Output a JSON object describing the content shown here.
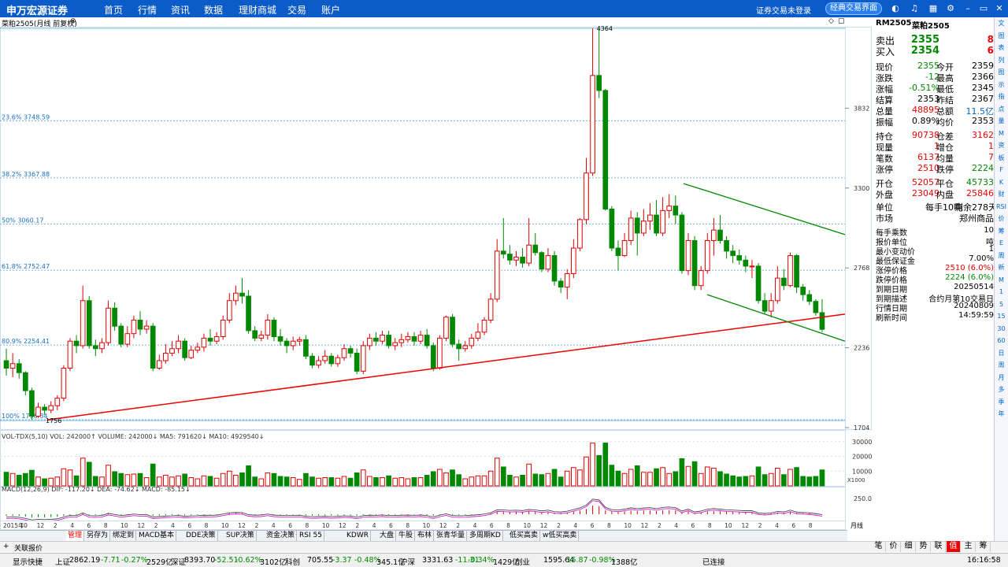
{
  "topbar": {
    "brand": "申万宏源证券",
    "nav": [
      "首页",
      "行情",
      "资讯",
      "数据",
      "理财商城",
      "交易",
      "账户"
    ],
    "status": "证券交易未登录",
    "classic_button": "经典交易界面"
  },
  "header": {
    "title": "菜粕2505(月线 前复权)"
  },
  "chart_data": [
    {
      "type": "candlestick",
      "title": "菜粕2505(月线 前复权)",
      "x_labels": [
        "2015年",
        "10",
        "12",
        "2",
        "4",
        "6",
        "8",
        "10",
        "12",
        "2",
        "4",
        "6",
        "8",
        "10",
        "12",
        "2",
        "4",
        "6",
        "8",
        "10",
        "12",
        "2",
        "4",
        "6",
        "8",
        "10",
        "12",
        "2",
        "4",
        "6",
        "8",
        "10",
        "12",
        "2",
        "4",
        "6",
        "8",
        "10",
        "12",
        "2",
        "4",
        "6",
        "8",
        "10",
        "12",
        "2",
        "4",
        "6",
        "8"
      ],
      "y_ticks": [
        1704,
        2236,
        2768,
        3300,
        3832
      ],
      "ylim": [
        1704,
        4364
      ],
      "fib_levels": [
        {
          "label": "23.6% 3748.59",
          "value": 3748.59
        },
        {
          "label": "38.2% 3367.88",
          "value": 3367.88
        },
        {
          "label": "50% 3060.17",
          "value": 3060.17
        },
        {
          "label": "61.8% 2752.47",
          "value": 2752.47
        },
        {
          "label": "80.9% 2254.41",
          "value": 2254.41
        },
        {
          "label": "100% 1756.34",
          "value": 1756.34
        }
      ],
      "annotations": [
        {
          "text": "4364",
          "value": 4364
        },
        {
          "text": "1756",
          "value": 1756.34
        }
      ],
      "candles": [
        [
          2150,
          2100,
          2230,
          2050
        ],
        [
          2100,
          2130,
          2200,
          2040
        ],
        [
          2130,
          2070,
          2160,
          2030
        ],
        [
          2070,
          1950,
          2080,
          1920
        ],
        [
          1950,
          1780,
          1970,
          1756
        ],
        [
          1780,
          1840,
          1870,
          1770
        ],
        [
          1840,
          1820,
          1860,
          1790
        ],
        [
          1820,
          1850,
          1880,
          1800
        ],
        [
          1850,
          1900,
          1920,
          1820
        ],
        [
          1900,
          2100,
          2120,
          1880
        ],
        [
          2100,
          2280,
          2300,
          2080
        ],
        [
          2280,
          2250,
          2320,
          2200
        ],
        [
          2250,
          2550,
          2650,
          2230
        ],
        [
          2550,
          2250,
          2580,
          2230
        ],
        [
          2250,
          2230,
          2290,
          2180
        ],
        [
          2230,
          2270,
          2300,
          2200
        ],
        [
          2270,
          2500,
          2550,
          2250
        ],
        [
          2500,
          2380,
          2540,
          2350
        ],
        [
          2380,
          2260,
          2400,
          2240
        ],
        [
          2260,
          2330,
          2380,
          2240
        ],
        [
          2330,
          2420,
          2450,
          2300
        ],
        [
          2420,
          2360,
          2480,
          2320
        ],
        [
          2360,
          2380,
          2420,
          2330
        ],
        [
          2380,
          2100,
          2400,
          2080
        ],
        [
          2100,
          2150,
          2190,
          2090
        ],
        [
          2150,
          2200,
          2260,
          2130
        ],
        [
          2200,
          2230,
          2280,
          2180
        ],
        [
          2230,
          2280,
          2320,
          2200
        ],
        [
          2280,
          2170,
          2300,
          2150
        ],
        [
          2170,
          2220,
          2250,
          2160
        ],
        [
          2220,
          2240,
          2270,
          2200
        ],
        [
          2240,
          2300,
          2330,
          2210
        ],
        [
          2300,
          2280,
          2360,
          2250
        ],
        [
          2280,
          2310,
          2340,
          2260
        ],
        [
          2310,
          2420,
          2450,
          2290
        ],
        [
          2420,
          2550,
          2600,
          2400
        ],
        [
          2550,
          2600,
          2650,
          2520
        ],
        [
          2600,
          2580,
          2700,
          2530
        ],
        [
          2580,
          2350,
          2620,
          2330
        ],
        [
          2350,
          2300,
          2380,
          2280
        ],
        [
          2300,
          2320,
          2350,
          2280
        ],
        [
          2320,
          2420,
          2460,
          2290
        ],
        [
          2420,
          2310,
          2440,
          2280
        ],
        [
          2310,
          2280,
          2360,
          2250
        ],
        [
          2280,
          2250,
          2300,
          2200
        ],
        [
          2250,
          2280,
          2310,
          2220
        ],
        [
          2280,
          2290,
          2310,
          2250
        ],
        [
          2290,
          2180,
          2320,
          2160
        ],
        [
          2180,
          2120,
          2200,
          2100
        ],
        [
          2120,
          2150,
          2180,
          2100
        ],
        [
          2150,
          2180,
          2220,
          2130
        ],
        [
          2180,
          2130,
          2200,
          2110
        ],
        [
          2130,
          2170,
          2190,
          2110
        ],
        [
          2170,
          2230,
          2260,
          2150
        ],
        [
          2230,
          2200,
          2250,
          2170
        ],
        [
          2200,
          2080,
          2230,
          2060
        ],
        [
          2080,
          2250,
          2280,
          2060
        ],
        [
          2250,
          2300,
          2330,
          2220
        ],
        [
          2300,
          2280,
          2340,
          2250
        ],
        [
          2280,
          2320,
          2350,
          2260
        ],
        [
          2320,
          2250,
          2350,
          2230
        ],
        [
          2250,
          2270,
          2300,
          2220
        ],
        [
          2270,
          2290,
          2330,
          2240
        ],
        [
          2290,
          2310,
          2340,
          2270
        ],
        [
          2310,
          2280,
          2340,
          2250
        ],
        [
          2280,
          2320,
          2350,
          2260
        ],
        [
          2320,
          2250,
          2360,
          2230
        ],
        [
          2250,
          2100,
          2270,
          2080
        ],
        [
          2100,
          2300,
          2320,
          2090
        ],
        [
          2300,
          2440,
          2450,
          2280
        ],
        [
          2440,
          2260,
          2460,
          2240
        ],
        [
          2260,
          2230,
          2290,
          2150
        ],
        [
          2230,
          2250,
          2280,
          2210
        ],
        [
          2250,
          2300,
          2330,
          2230
        ],
        [
          2300,
          2340,
          2400,
          2280
        ],
        [
          2340,
          2420,
          2440,
          2320
        ],
        [
          2420,
          2560,
          2600,
          2400
        ],
        [
          2560,
          2880,
          2960,
          2540
        ],
        [
          2880,
          2860,
          3100,
          2830
        ],
        [
          2860,
          2820,
          2920,
          2790
        ],
        [
          2820,
          2840,
          2880,
          2780
        ],
        [
          2840,
          2800,
          2900,
          2770
        ],
        [
          2800,
          2920,
          3100,
          2780
        ],
        [
          2920,
          2870,
          3000,
          2850
        ],
        [
          2870,
          2760,
          2880,
          2740
        ],
        [
          2760,
          2850,
          2900,
          2740
        ],
        [
          2850,
          2680,
          2880,
          2650
        ],
        [
          2680,
          2640,
          2700,
          2600
        ],
        [
          2640,
          2730,
          2760,
          2560
        ],
        [
          2730,
          2900,
          2960,
          2700
        ],
        [
          2900,
          3090,
          3100,
          2880
        ],
        [
          3090,
          3400,
          3500,
          3060
        ],
        [
          3400,
          4050,
          4364,
          3380
        ],
        [
          4050,
          3950,
          4364,
          3900
        ],
        [
          3950,
          3160,
          3960,
          3150
        ],
        [
          3160,
          2900,
          3180,
          2880
        ],
        [
          2900,
          2850,
          2950,
          2750
        ],
        [
          2850,
          2950,
          3000,
          2840
        ],
        [
          2950,
          3100,
          3150,
          2920
        ],
        [
          3100,
          3000,
          3140,
          2850
        ],
        [
          3000,
          3080,
          3160,
          2980
        ],
        [
          3080,
          3120,
          3200,
          3020
        ],
        [
          3120,
          3000,
          3220,
          2980
        ],
        [
          3000,
          3150,
          3240,
          2980
        ],
        [
          3150,
          3180,
          3260,
          3100
        ],
        [
          3180,
          3120,
          3250,
          3060
        ],
        [
          3120,
          2750,
          3140,
          2730
        ],
        [
          2750,
          2950,
          3000,
          2720
        ],
        [
          2950,
          2650,
          2980,
          2620
        ],
        [
          2650,
          2750,
          2780,
          2620
        ],
        [
          2750,
          2950,
          3000,
          2730
        ],
        [
          2950,
          3020,
          3100,
          2850
        ],
        [
          3020,
          2950,
          3120,
          2930
        ],
        [
          2950,
          2880,
          2980,
          2830
        ],
        [
          2880,
          2850,
          2920,
          2800
        ],
        [
          2850,
          2820,
          2890,
          2790
        ],
        [
          2820,
          2780,
          2850,
          2740
        ],
        [
          2780,
          2780,
          2820,
          2700
        ],
        [
          2780,
          2550,
          2800,
          2530
        ],
        [
          2550,
          2480,
          2600,
          2460
        ],
        [
          2480,
          2550,
          2600,
          2440
        ],
        [
          2550,
          2700,
          2780,
          2530
        ],
        [
          2700,
          2650,
          2760,
          2620
        ],
        [
          2650,
          2850,
          2870,
          2640
        ],
        [
          2850,
          2640,
          2860,
          2600
        ],
        [
          2640,
          2590,
          2660,
          2550
        ],
        [
          2590,
          2545,
          2620,
          2520
        ],
        [
          2545,
          2470,
          2560,
          2450
        ],
        [
          2470,
          2359,
          2560,
          2340
        ]
      ]
    },
    {
      "type": "bar",
      "title": "VOL-TDX(5,10)",
      "series": [
        {
          "name": "VOLUME",
          "value": 242000
        },
        {
          "name": "MA5",
          "value": 791620
        },
        {
          "name": "MA10",
          "value": 4929540
        }
      ],
      "y_ticks": [
        10000,
        20000,
        30000
      ],
      "scale_label": "X1000"
    },
    {
      "type": "line",
      "title": "MACD(12,26,9)",
      "series": [
        {
          "name": "DIF",
          "value": -117.2
        },
        {
          "name": "DEA",
          "value": -74.62
        },
        {
          "name": "MACD",
          "value": -85.15
        }
      ],
      "y_ticks": [
        250.0
      ]
    }
  ],
  "panels": {
    "vol_header": "VOL-TDX(5,10) VOL: 242000↑ VOLUME: 242000↓ MA5: 791620↓ MA10: 4929540↓",
    "macd_header": "MACD(12,26,9) DIF: -117.20↓ DEA: -74.62↓ MACD: -85.15↓",
    "period": "月线"
  },
  "quote": {
    "code": "RM2505",
    "name": "菜粕2505",
    "sell": {
      "label": "卖出",
      "price": "2355",
      "vol": "8"
    },
    "buy": {
      "label": "买入",
      "price": "2354",
      "vol": "6"
    },
    "rows1": [
      [
        "现价",
        "2355",
        "今开",
        "2359"
      ],
      [
        "涨跌",
        "-12",
        "最高",
        "2366"
      ],
      [
        "涨幅",
        "-0.51%",
        "最低",
        "2345"
      ],
      [
        "结算",
        "2353",
        "昨结",
        "2367"
      ],
      [
        "总量",
        "48895",
        "总额",
        "11.5亿"
      ],
      [
        "振幅",
        "0.89%",
        "均价",
        "2353"
      ]
    ],
    "rows2": [
      [
        "持仓",
        "90738",
        "仓差",
        "3162"
      ],
      [
        "现量",
        "1",
        "增仓",
        "1"
      ],
      [
        "笔数",
        "6137",
        "均量",
        "7"
      ],
      [
        "涨停",
        "2510",
        "跌停",
        "2224"
      ]
    ],
    "rows3": [
      [
        "开仓",
        "52057",
        "平仓",
        "45733"
      ],
      [
        "外盘",
        "23049",
        "内盘",
        "25846"
      ]
    ],
    "unit_label": "单位",
    "unit_val": "每手10吨",
    "remaining": "剩余278天",
    "market_label": "市场",
    "market_val": "郑州商品",
    "specs": [
      [
        "每手乘数",
        "10"
      ],
      [
        "报价单位",
        "吨"
      ],
      [
        "最小变动价",
        "1"
      ],
      [
        "最低保证金",
        "7.00%"
      ],
      [
        "涨停价格",
        "2510 (6.0%)"
      ],
      [
        "跌停价格",
        "2224 (6.0%)"
      ],
      [
        "到期日期",
        "20250514"
      ],
      [
        "到期描述",
        "合约月第10交易日"
      ],
      [
        "行情日期",
        "20240809"
      ],
      [
        "刷新时间",
        "14:59:59"
      ]
    ]
  },
  "tabs": [
    "管理",
    "另存为",
    "绑定到",
    "MACD基本",
    "DDE决策",
    "SUP决策",
    "资金决策",
    "RSI 55",
    "KDWR",
    "大盘",
    "牛股",
    "布林",
    "张青华量",
    "多周期KD",
    "低买高卖",
    "w低买高卖"
  ],
  "linkbar": {
    "label": "关联报价"
  },
  "bottom_tabs": [
    "笔",
    "价",
    "细",
    "势",
    "联",
    "值",
    "主",
    "筹"
  ],
  "status": {
    "items": [
      "显示快捷",
      "上证",
      "2862.19",
      "-7.71",
      "-0.27%",
      "2529亿",
      "深证",
      "8393.70",
      "-52.51",
      "-0.62%",
      "3102亿",
      "科创",
      "705.55",
      "-3.37",
      "-0.48%",
      "345.1亿",
      "沪深",
      "3331.63",
      "-11.31",
      "-0.34%",
      "1429亿",
      "创业",
      "1595.64",
      "-15.87",
      "-0.98%",
      "1388亿",
      "已连接",
      "16:16:58"
    ]
  },
  "right_icons": [
    "文",
    "图",
    "表",
    "列",
    "图",
    "示",
    "指",
    "点",
    "量",
    "M",
    "资",
    "板",
    "F",
    "K",
    "财",
    "RSI",
    "价",
    "筹",
    "E",
    "周",
    "新",
    "M",
    "1",
    "5",
    "15",
    "30",
    "60",
    "日",
    "周",
    "月",
    "多",
    "季",
    "年"
  ],
  "colors": {
    "up": "#e00000",
    "down": "#008800",
    "topbar": "#0b5cc9"
  }
}
